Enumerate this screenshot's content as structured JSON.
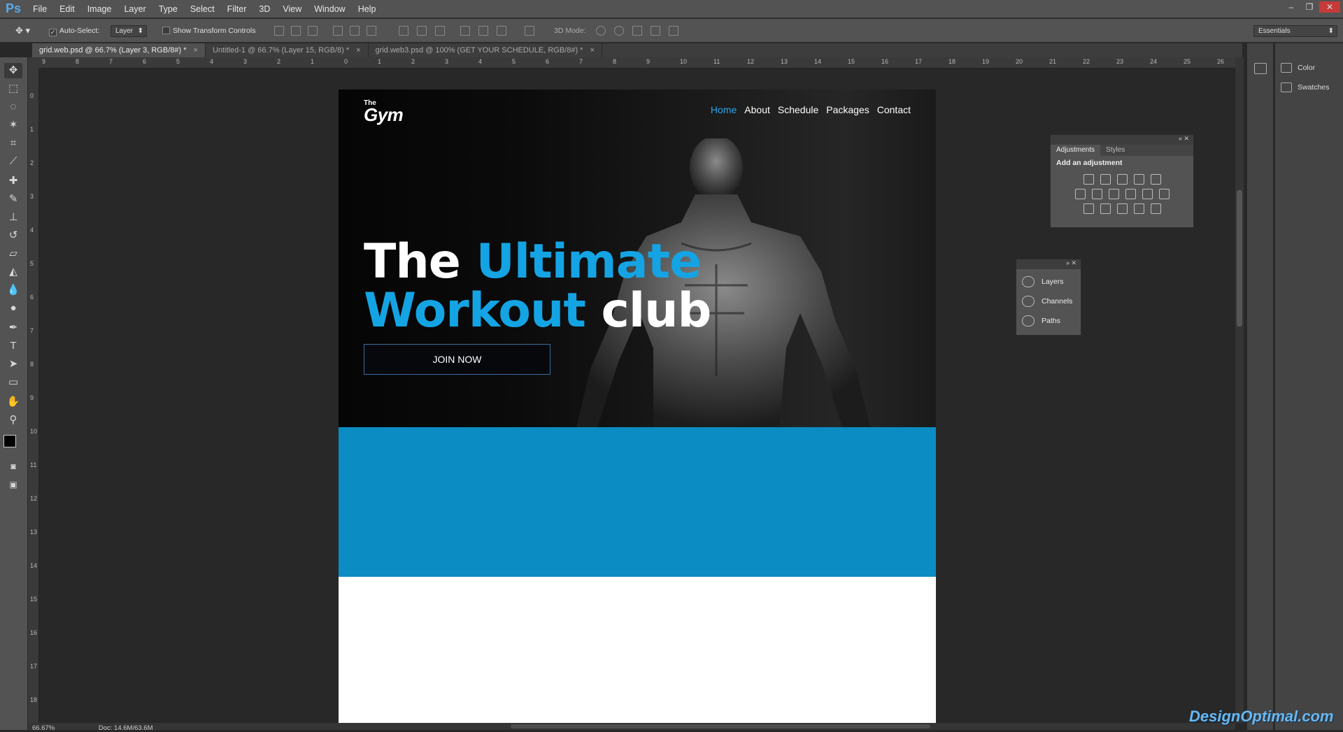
{
  "app": {
    "logo": "Ps"
  },
  "menu": [
    "File",
    "Edit",
    "Image",
    "Layer",
    "Type",
    "Select",
    "Filter",
    "3D",
    "View",
    "Window",
    "Help"
  ],
  "options": {
    "auto_select_label": "Auto-Select:",
    "auto_select_checked": "✓",
    "layer_value": "Layer",
    "show_transform_label": "Show Transform Controls",
    "mode_label": "3D Mode:",
    "workspace": "Essentials"
  },
  "tabs": [
    {
      "label": "grid.web.psd @ 66.7% (Layer 3, RGB/8#) *",
      "close": "×"
    },
    {
      "label": "Untitled-1 @ 66.7% (Layer 15, RGB/8) *",
      "close": "×"
    },
    {
      "label": "grid.web3.psd @ 100% (GET YOUR SCHEDULE, RGB/8#) *",
      "close": "×"
    }
  ],
  "ruler": {
    "h": [
      "9",
      "8",
      "7",
      "6",
      "5",
      "4",
      "3",
      "2",
      "1",
      "0",
      "1",
      "2",
      "3",
      "4",
      "5",
      "6",
      "7",
      "8",
      "9",
      "10",
      "11",
      "12",
      "13",
      "14",
      "15",
      "16",
      "17",
      "18",
      "19",
      "20",
      "21",
      "22",
      "23",
      "24",
      "25",
      "26"
    ],
    "v": [
      "0",
      "1",
      "2",
      "3",
      "4",
      "5",
      "6",
      "7",
      "8",
      "9",
      "10",
      "11",
      "12",
      "13",
      "14",
      "15",
      "16",
      "17",
      "18"
    ]
  },
  "site": {
    "logo_the": "The",
    "logo_gym": "Gym",
    "nav": [
      "Home",
      "About",
      "Schedule",
      "Packages",
      "Contact"
    ],
    "headline_1a": "The ",
    "headline_1b": "Ultimate",
    "headline_2a": "Workout",
    "headline_2b": " club",
    "cta": "JOIN NOW"
  },
  "panels": {
    "adjustments_tab": "Adjustments",
    "styles_tab": "Styles",
    "adjust_title": "Add an adjustment",
    "layers": "Layers",
    "channels": "Channels",
    "paths": "Paths",
    "color": "Color",
    "swatches": "Swatches"
  },
  "status": {
    "zoom": "66.67%",
    "doc": "Doc: 14.6M/63.6M"
  },
  "watermark": "DesignOptimal.com",
  "colors": {
    "accent": "#14a4e4",
    "band": "#0b8cc2",
    "ps_chrome": "#535353"
  }
}
